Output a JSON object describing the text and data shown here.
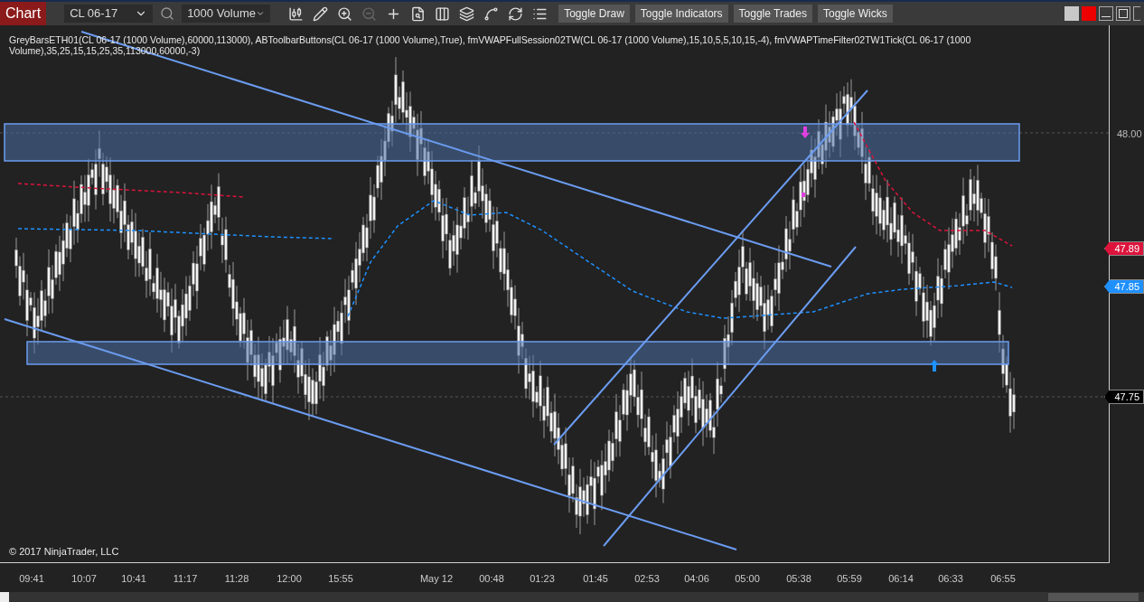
{
  "toolbar": {
    "chart_tab": "Chart",
    "instrument": "CL 06-17",
    "interval": "1000 Volume",
    "toggles": [
      "Toggle Draw",
      "Toggle Indicators",
      "Toggle Trades",
      "Toggle Wicks"
    ]
  },
  "indicator_label": "GreyBarsETH01(CL 06-17 (1000 Volume),60000,113000), ABToolbarButtons(CL 06-17 (1000 Volume),True), fmVWAPFullSession02TW(CL 06-17 (1000 Volume),15,10,5,5,10,15,-4), fmVWAPTimeFilter02TW1Tick(CL 06-17 (1000 Volume),35,25,15,15,25,35,113000,60000,-3)",
  "copyright": "© 2017 NinjaTrader, LLC",
  "price_axis": [
    {
      "text": "48.00",
      "kind": "tick"
    },
    {
      "text": "47.89",
      "kind": "marker",
      "color": "#dc143c"
    },
    {
      "text": "47.85",
      "kind": "marker",
      "color": "#1e90ff"
    },
    {
      "text": "47.75",
      "kind": "marker",
      "color": "#000000"
    }
  ],
  "time_axis": [
    "09:41",
    "10:07",
    "10:41",
    "11:17",
    "11:28",
    "12:00",
    "15:55",
    "May 12",
    "00:48",
    "01:23",
    "01:45",
    "02:53",
    "04:06",
    "05:00",
    "05:38",
    "05:59",
    "06:14",
    "06:33",
    "06:55"
  ]
}
